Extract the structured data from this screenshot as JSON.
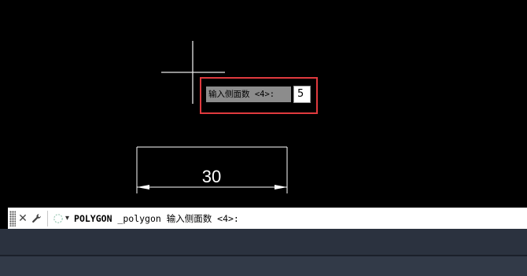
{
  "drawing": {
    "prompt_label": "输入侧面数 <4>:",
    "sides_value": "5",
    "dimension_value": "30"
  },
  "command_line": {
    "command_name": "POLYGON",
    "command_text": " _polygon 输入侧面数 <4>:",
    "close_glyph": "✕",
    "customize_glyph": "🔧",
    "dropdown_glyph": "▾"
  },
  "colors": {
    "canvas": "#000000",
    "highlight_box": "#e03a3e",
    "command_bar": "#ffffff",
    "panel": "#2b323f"
  }
}
